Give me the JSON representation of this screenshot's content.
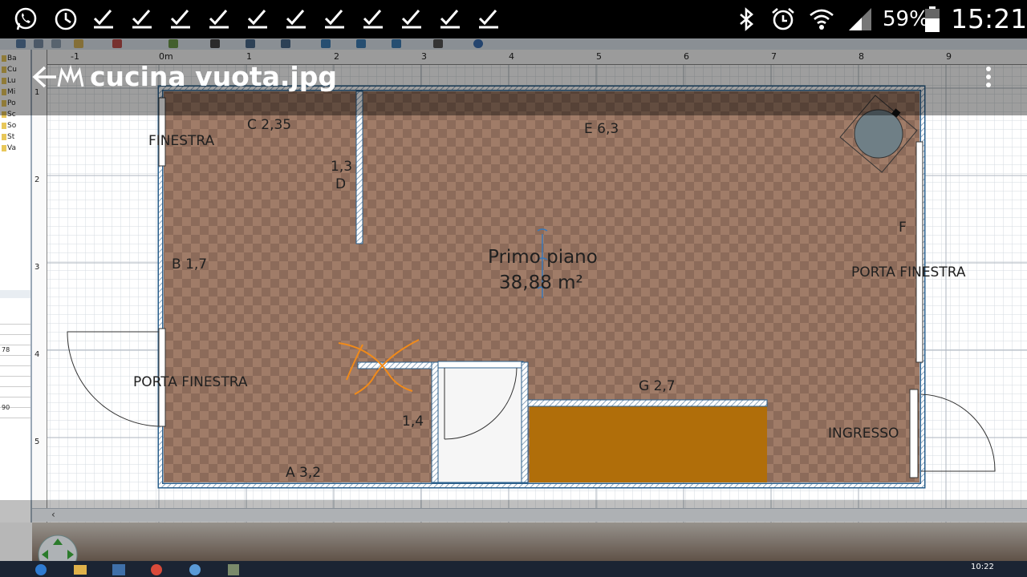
{
  "status_bar": {
    "battery_percent": "59%",
    "time": "15:21",
    "icons": [
      "whatsapp-icon",
      "sync-icon",
      "check-icon",
      "bluetooth-icon",
      "alarm-icon",
      "wifi-icon",
      "signal-icon",
      "battery-icon"
    ]
  },
  "viewer": {
    "title": "cucina vuota.jpg",
    "back_icon": "back-arrow-icon",
    "app_icon": "gallery-crown-icon",
    "menu_icon": "overflow-menu-icon"
  },
  "ruler": {
    "top": [
      "-1",
      "0m",
      "1",
      "2",
      "3",
      "4",
      "5",
      "6",
      "7",
      "8",
      "9"
    ],
    "left": [
      "1",
      "2",
      "3",
      "4",
      "5"
    ]
  },
  "left_panel": {
    "items": [
      "Ba",
      "Cu",
      "Lu",
      "Mi",
      "Po",
      "Sc",
      "So",
      "St",
      "Va"
    ],
    "values": [
      "78",
      "90"
    ]
  },
  "plan": {
    "room_name": "Primo piano",
    "room_area": "38,88 m²",
    "labels": {
      "c": "C  2,35",
      "e": "E  6,3",
      "finestra": "FINESTRA",
      "d_value": "1,3",
      "d": "D",
      "b": "B  1,7",
      "f": "F",
      "porta_finestra_right": "PORTA FINESTRA",
      "porta_finestra_left": "PORTA FINESTRA",
      "g": "G  2,7",
      "inner_value": "1,4",
      "a": "A  3,2",
      "ingresso": "INGRESSO"
    }
  },
  "taskbar": {
    "clock": "10:22"
  },
  "colors": {
    "floor": "#8c6a58",
    "wall": "#3a78a8",
    "counter": "#b06e0a",
    "annotation": "#f08a1a",
    "grid": "#cfd4da"
  }
}
